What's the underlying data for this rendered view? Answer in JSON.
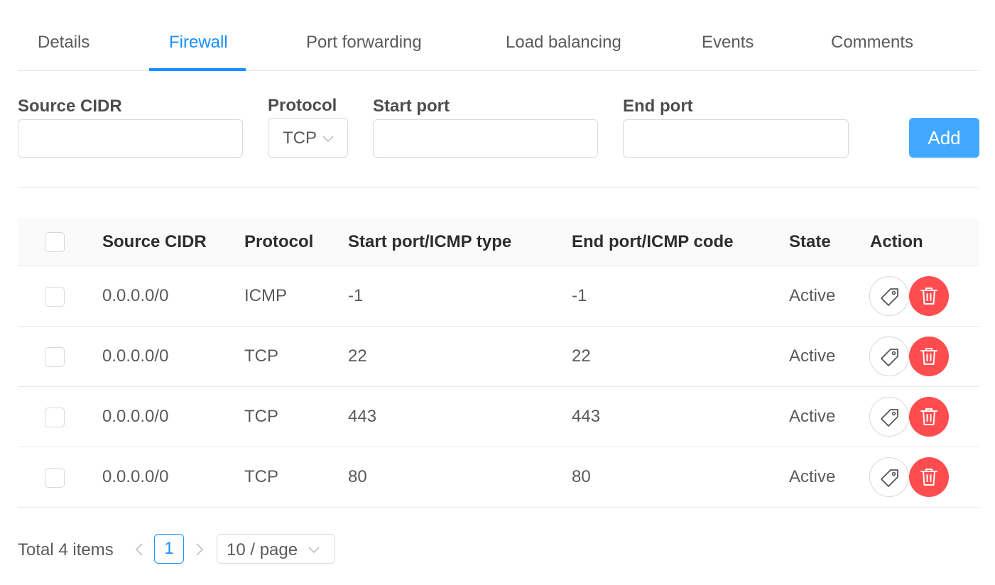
{
  "tabs": [
    {
      "label": "Details",
      "active": false
    },
    {
      "label": "Firewall",
      "active": true
    },
    {
      "label": "Port forwarding",
      "active": false
    },
    {
      "label": "Load balancing",
      "active": false
    },
    {
      "label": "Events",
      "active": false
    },
    {
      "label": "Comments",
      "active": false
    }
  ],
  "form": {
    "source_cidr_label": "Source CIDR",
    "source_cidr_value": "",
    "protocol_label": "Protocol",
    "protocol_value": "TCP",
    "start_port_label": "Start port",
    "start_port_value": "",
    "end_port_label": "End port",
    "end_port_value": "",
    "add_label": "Add"
  },
  "table": {
    "columns": [
      "Source CIDR",
      "Protocol",
      "Start port/ICMP type",
      "End port/ICMP code",
      "State",
      "Action"
    ],
    "rows": [
      {
        "source_cidr": "0.0.0.0/0",
        "protocol": "ICMP",
        "start": "-1",
        "end": "-1",
        "state": "Active"
      },
      {
        "source_cidr": "0.0.0.0/0",
        "protocol": "TCP",
        "start": "22",
        "end": "22",
        "state": "Active"
      },
      {
        "source_cidr": "0.0.0.0/0",
        "protocol": "TCP",
        "start": "443",
        "end": "443",
        "state": "Active"
      },
      {
        "source_cidr": "0.0.0.0/0",
        "protocol": "TCP",
        "start": "80",
        "end": "80",
        "state": "Active"
      }
    ],
    "row_action_icons": [
      "tag-icon",
      "trash-icon"
    ]
  },
  "pagination": {
    "total_label": "Total 4 items",
    "current_page": "1",
    "page_size": "10 / page"
  },
  "colors": {
    "primary": "#1890ff",
    "add_button": "#40a9ff",
    "danger": "#ff4d4f",
    "border": "#d9d9d9",
    "header_bg": "#fafafa"
  }
}
